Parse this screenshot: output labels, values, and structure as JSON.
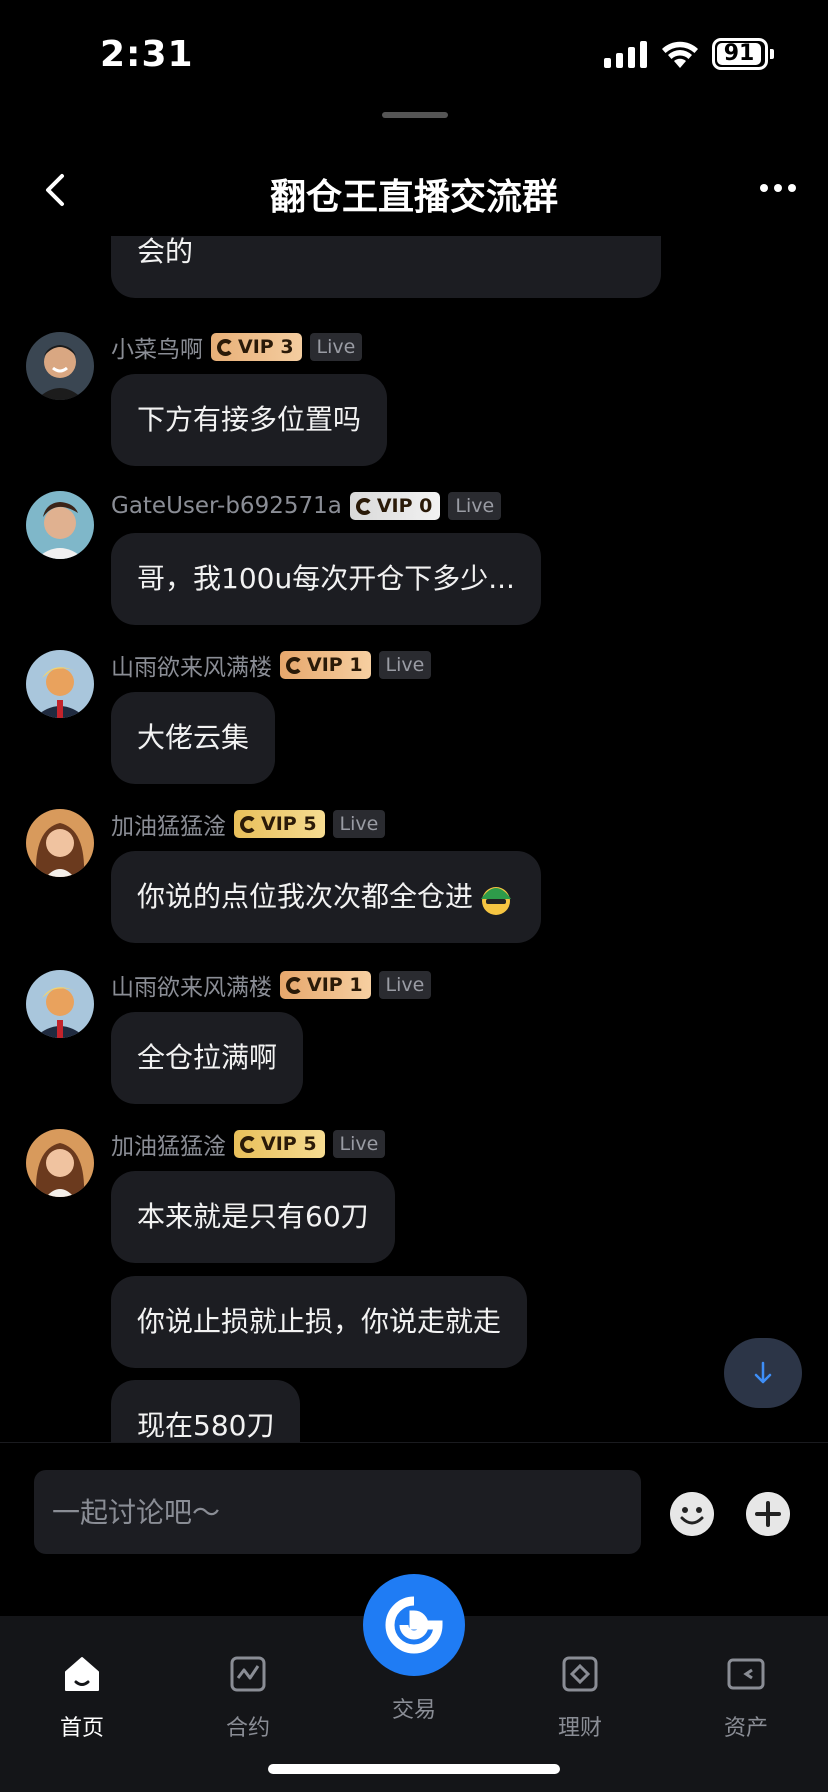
{
  "status": {
    "time": "2:31",
    "battery": "91"
  },
  "header": {
    "title": "翻仓王直播交流群"
  },
  "messages": {
    "m0": {
      "text": "会的"
    },
    "m1": {
      "user": "小菜鸟啊",
      "vip": "VIP 3",
      "live": "Live",
      "text": "下方有接多位置吗"
    },
    "m2": {
      "user": "GateUser-b692571a",
      "vip": "VIP 0",
      "live": "Live",
      "text": "哥，我100u每次开仓下多少..."
    },
    "m3": {
      "user": "山雨欲来风满楼",
      "vip": "VIP 1",
      "live": "Live",
      "text": "大佬云集"
    },
    "m4": {
      "user": "加油猛猛淦",
      "vip": "VIP 5",
      "live": "Live",
      "text": "你说的点位我次次都全仓进"
    },
    "m5": {
      "user": "山雨欲来风满楼",
      "vip": "VIP 1",
      "live": "Live",
      "text": "全仓拉满啊"
    },
    "m6": {
      "user": "加油猛猛淦",
      "vip": "VIP 5",
      "live": "Live",
      "text": "本来就是只有60刀"
    },
    "m7": {
      "text": "你说止损就止损，你说走就走"
    },
    "m8": {
      "text": "现在580刀"
    }
  },
  "input": {
    "placeholder": "一起讨论吧～"
  },
  "tabs": {
    "home": "首页",
    "contract": "合约",
    "trade": "交易",
    "finance": "理财",
    "assets": "资产"
  },
  "colors": {
    "accent": "#1f7cf4",
    "bubble": "#1c1d22",
    "background": "#000000"
  }
}
